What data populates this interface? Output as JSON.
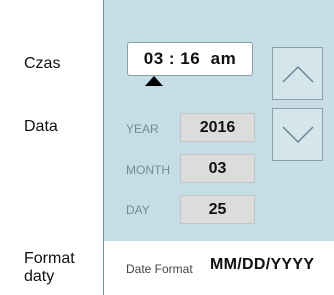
{
  "labels": {
    "time": "Czas",
    "date": "Data",
    "format": "Format\ndaty"
  },
  "time": {
    "value": "03 : 16  am"
  },
  "date": {
    "year_label": "YEAR",
    "year_value": "2016",
    "month_label": "MONTH",
    "month_value": "03",
    "day_label": "DAY",
    "day_value": "25"
  },
  "format": {
    "caption": "Date Format",
    "value": "MM/DD/YYYY"
  },
  "icons": {
    "up": "chevron-up-icon",
    "down": "chevron-down-icon",
    "caret": "caret-up-icon"
  },
  "colors": {
    "panel": "#c7dde6",
    "field": "#dcdcdc"
  }
}
